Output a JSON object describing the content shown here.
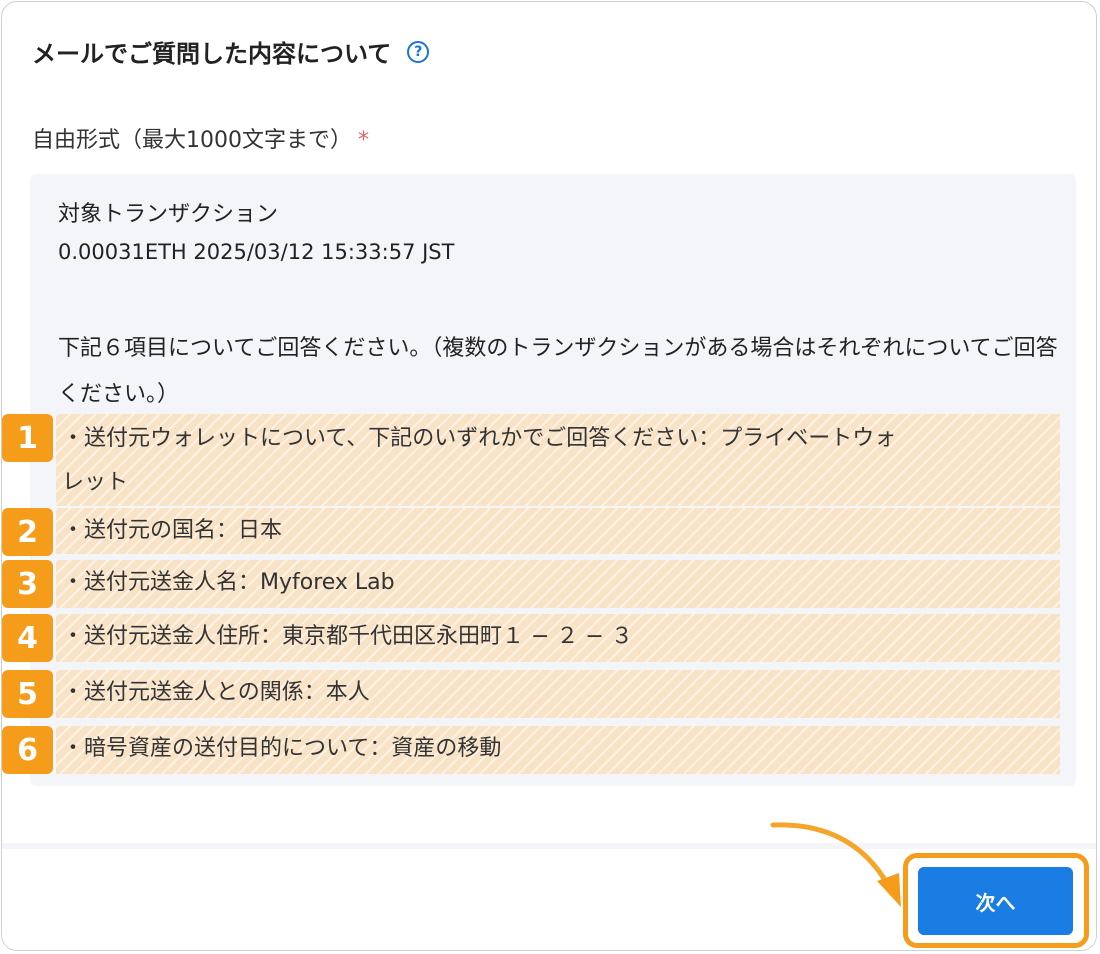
{
  "dialog": {
    "title": "メールでご質問した内容について",
    "help_icon": "question-circle-icon"
  },
  "field": {
    "label": "自由形式（最大1000文字まで）",
    "required_mark": "*"
  },
  "content": {
    "line1": "対象トランザクション",
    "line2": "0.00031ETH 2025/03/12 15:33:57 JST",
    "intro": "下記６項目についてご回答ください。（複数のトランザクションがある場合はそれぞれについてご回答ください。）",
    "items": [
      {
        "badge": "1",
        "text_a": "・送付元ウォレットについて、下記のいずれかでご回答ください：プライベートウォ",
        "text_b": "レット"
      },
      {
        "badge": "2",
        "text": "・送付元の国名：日本"
      },
      {
        "badge": "3",
        "text": "・送付元送金人名：Myforex Lab"
      },
      {
        "badge": "4",
        "text": "・送付元送金人住所：東京都千代田区永田町１ − ２ − ３"
      },
      {
        "badge": "5",
        "text": "・送付元送金人との関係：本人"
      },
      {
        "badge": "6",
        "text": "・暗号資産の送付目的について：資産の移動"
      }
    ]
  },
  "footer": {
    "next_label": "次へ"
  },
  "colors": {
    "accent": "#1a7de3",
    "highlight_orange": "#f59c1a",
    "required": "#e06666",
    "textarea_bg": "#f4f5f8"
  }
}
